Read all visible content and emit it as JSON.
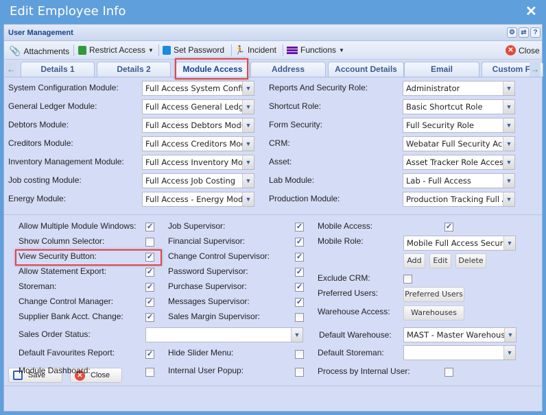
{
  "window": {
    "title": "Edit Employee Info",
    "close_icon": "close-icon"
  },
  "panel": {
    "title": "User Management"
  },
  "toolbar": {
    "attachments": "Attachments",
    "restrict_access": "Restrict Access",
    "set_password": "Set Password",
    "incident": "Incident",
    "functions": "Functions",
    "close": "Close"
  },
  "tabs": [
    "Details 1",
    "Details 2",
    "Module Access",
    "Address",
    "Account Details",
    "Email",
    "Custom Fi"
  ],
  "active_tab": "Module Access",
  "modules_left": [
    {
      "label": "System Configuration Module:",
      "value": "Full Access System Config"
    },
    {
      "label": "General Ledger Module:",
      "value": "Full Access General Ledger"
    },
    {
      "label": "Debtors Module:",
      "value": "Full Access Debtors Module"
    },
    {
      "label": "Creditors Module:",
      "value": "Full Access Creditors Module"
    },
    {
      "label": "Inventory Management Module:",
      "value": "Full Access Inventory Module"
    },
    {
      "label": "Job costing Module:",
      "value": "Full Access Job Costing"
    },
    {
      "label": "Energy Module:",
      "value": "Full Access - Energy Module"
    }
  ],
  "modules_right": [
    {
      "label": "Reports And Security Role:",
      "value": "Administrator"
    },
    {
      "label": "Shortcut Role:",
      "value": "Basic Shortcut Role"
    },
    {
      "label": "Form Security:",
      "value": "Full Security Role"
    },
    {
      "label": "CRM:",
      "value": "Webatar Full Security Access"
    },
    {
      "label": "Asset:",
      "value": "Asset Tracker Role Access"
    },
    {
      "label": "Lab Module:",
      "value": "Lab - Full Access"
    },
    {
      "label": "Production Module:",
      "value": "Production Tracking Full Access"
    }
  ],
  "checks_col1": [
    {
      "label": "Allow Multiple Module Windows:",
      "checked": true
    },
    {
      "label": "Show Column Selector:",
      "checked": false
    },
    {
      "label": "View Security Button:",
      "checked": true
    },
    {
      "label": "Allow Statement Export:",
      "checked": true
    },
    {
      "label": "Storeman:",
      "checked": true
    },
    {
      "label": "Change Control Manager:",
      "checked": true
    },
    {
      "label": "Supplier Bank Acct. Change:",
      "checked": true
    }
  ],
  "checks_col2": [
    {
      "label": "Job Supervisor:",
      "checked": true
    },
    {
      "label": "Financial Supervisor:",
      "checked": true
    },
    {
      "label": "Change Control Supervisor:",
      "checked": true
    },
    {
      "label": "Password Supervisor:",
      "checked": true
    },
    {
      "label": "Purchase Supervisor:",
      "checked": true
    },
    {
      "label": "Messages Supervisor:",
      "checked": true
    },
    {
      "label": "Sales Margin Supervisor:",
      "checked": false
    }
  ],
  "sales_order_status": {
    "label": "Sales Order Status:",
    "value": ""
  },
  "default_favourites": {
    "label": "Default Favourites Report:",
    "checked": true
  },
  "hide_slider": {
    "label": "Hide Slider Menu:",
    "checked": false
  },
  "module_dashboard": {
    "label": "Module Dashboard:",
    "checked": false
  },
  "internal_popup": {
    "label": "Internal User Popup:",
    "checked": false
  },
  "mobile_access": {
    "label": "Mobile Access:",
    "checked": true
  },
  "mobile_role": {
    "label": "Mobile Role:",
    "value": "Mobile Full Access Security",
    "add": "Add",
    "edit": "Edit",
    "delete": "Delete"
  },
  "exclude_crm": {
    "label": "Exclude CRM:",
    "checked": false
  },
  "preferred_users": {
    "label": "Preferred Users:",
    "button": "Preferred Users"
  },
  "warehouse_access": {
    "label": "Warehouse Access:",
    "button": "Warehouses"
  },
  "default_warehouse": {
    "label": "Default Warehouse:",
    "value": "MAST - Master Warehouse"
  },
  "default_storeman": {
    "label": "Default Storeman:",
    "value": ""
  },
  "process_internal": {
    "label": "Process by Internal User:",
    "checked": false
  },
  "footer": {
    "save": "Save",
    "close": "Close"
  }
}
